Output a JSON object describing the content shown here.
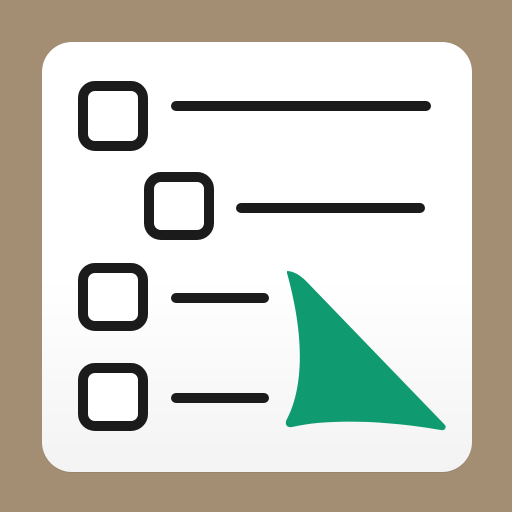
{
  "icon": {
    "kind": "checklist-app-icon",
    "colors": {
      "background": "#a38e74",
      "card": "#ffffff",
      "stroke": "#1b1b1b",
      "arrow": "#0f9a6f"
    },
    "items": [
      {
        "name": "item-1",
        "indent": 0,
        "line": "long"
      },
      {
        "name": "item-2",
        "indent": 1,
        "line": "long"
      },
      {
        "name": "item-3",
        "indent": 0,
        "line": "short"
      },
      {
        "name": "item-4",
        "indent": 0,
        "line": "short"
      }
    ]
  }
}
